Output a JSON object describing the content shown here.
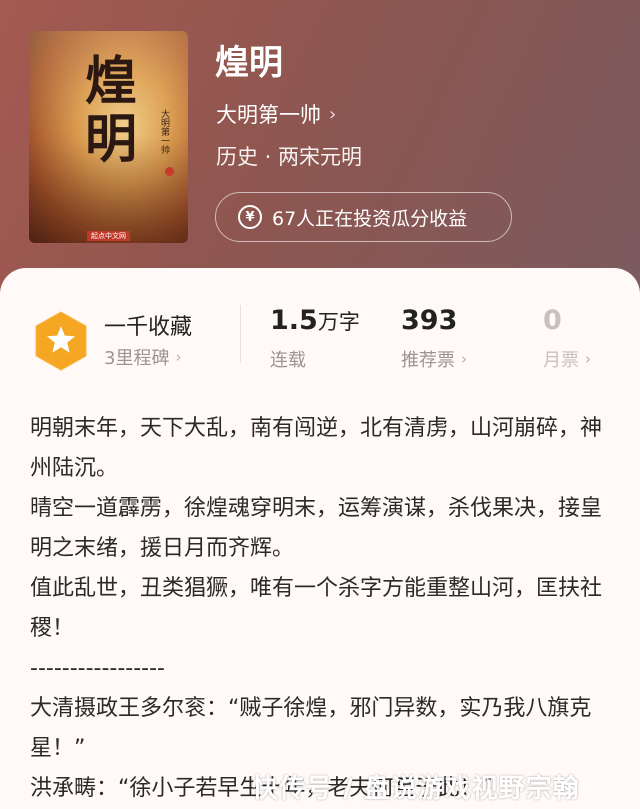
{
  "book": {
    "title": "煌明",
    "cover_title": "煌明",
    "cover_author": "大明第一帅",
    "cover_publisher": "起点中文网",
    "author": "大明第一帅",
    "genre": "历史 · 两宋元明",
    "invest_text": "67人正在投资瓜分收益"
  },
  "stats": {
    "collection": {
      "label": "一千收藏",
      "sub": "3里程碑"
    },
    "words": {
      "value": "1.5",
      "unit": "万字",
      "sub": "连载"
    },
    "recommend": {
      "value": "393",
      "sub": "推荐票"
    },
    "monthly": {
      "value": "0",
      "sub": "月票"
    }
  },
  "description": [
    "明朝末年，天下大乱，南有闯逆，北有清虏，山河崩碎，神州陆沉。",
    "晴空一道霹雳，徐煌魂穿明末，运筹演谋，杀伐果决，接皇明之末绪，援日月而齐辉。",
    "值此乱世，丑类猖獗，唯有一个杀字方能重整山河，匡扶社稷！",
    "-----------------",
    "大清摄政王多尔衮：“贼子徐煌，邪门异数，实乃我八旗克星！”",
    "洪承畴：“徐小子若早生十年，老夫何至于此！”"
  ],
  "watermark": "快传号 / 盘说游戏视野宗翰",
  "icons": {
    "chevron": "›",
    "yen": "¥"
  },
  "colors": {
    "header_bg": "#8e5650",
    "badge_orange": "#f5a623",
    "text_primary": "#222222",
    "text_secondary": "#9a9593"
  }
}
